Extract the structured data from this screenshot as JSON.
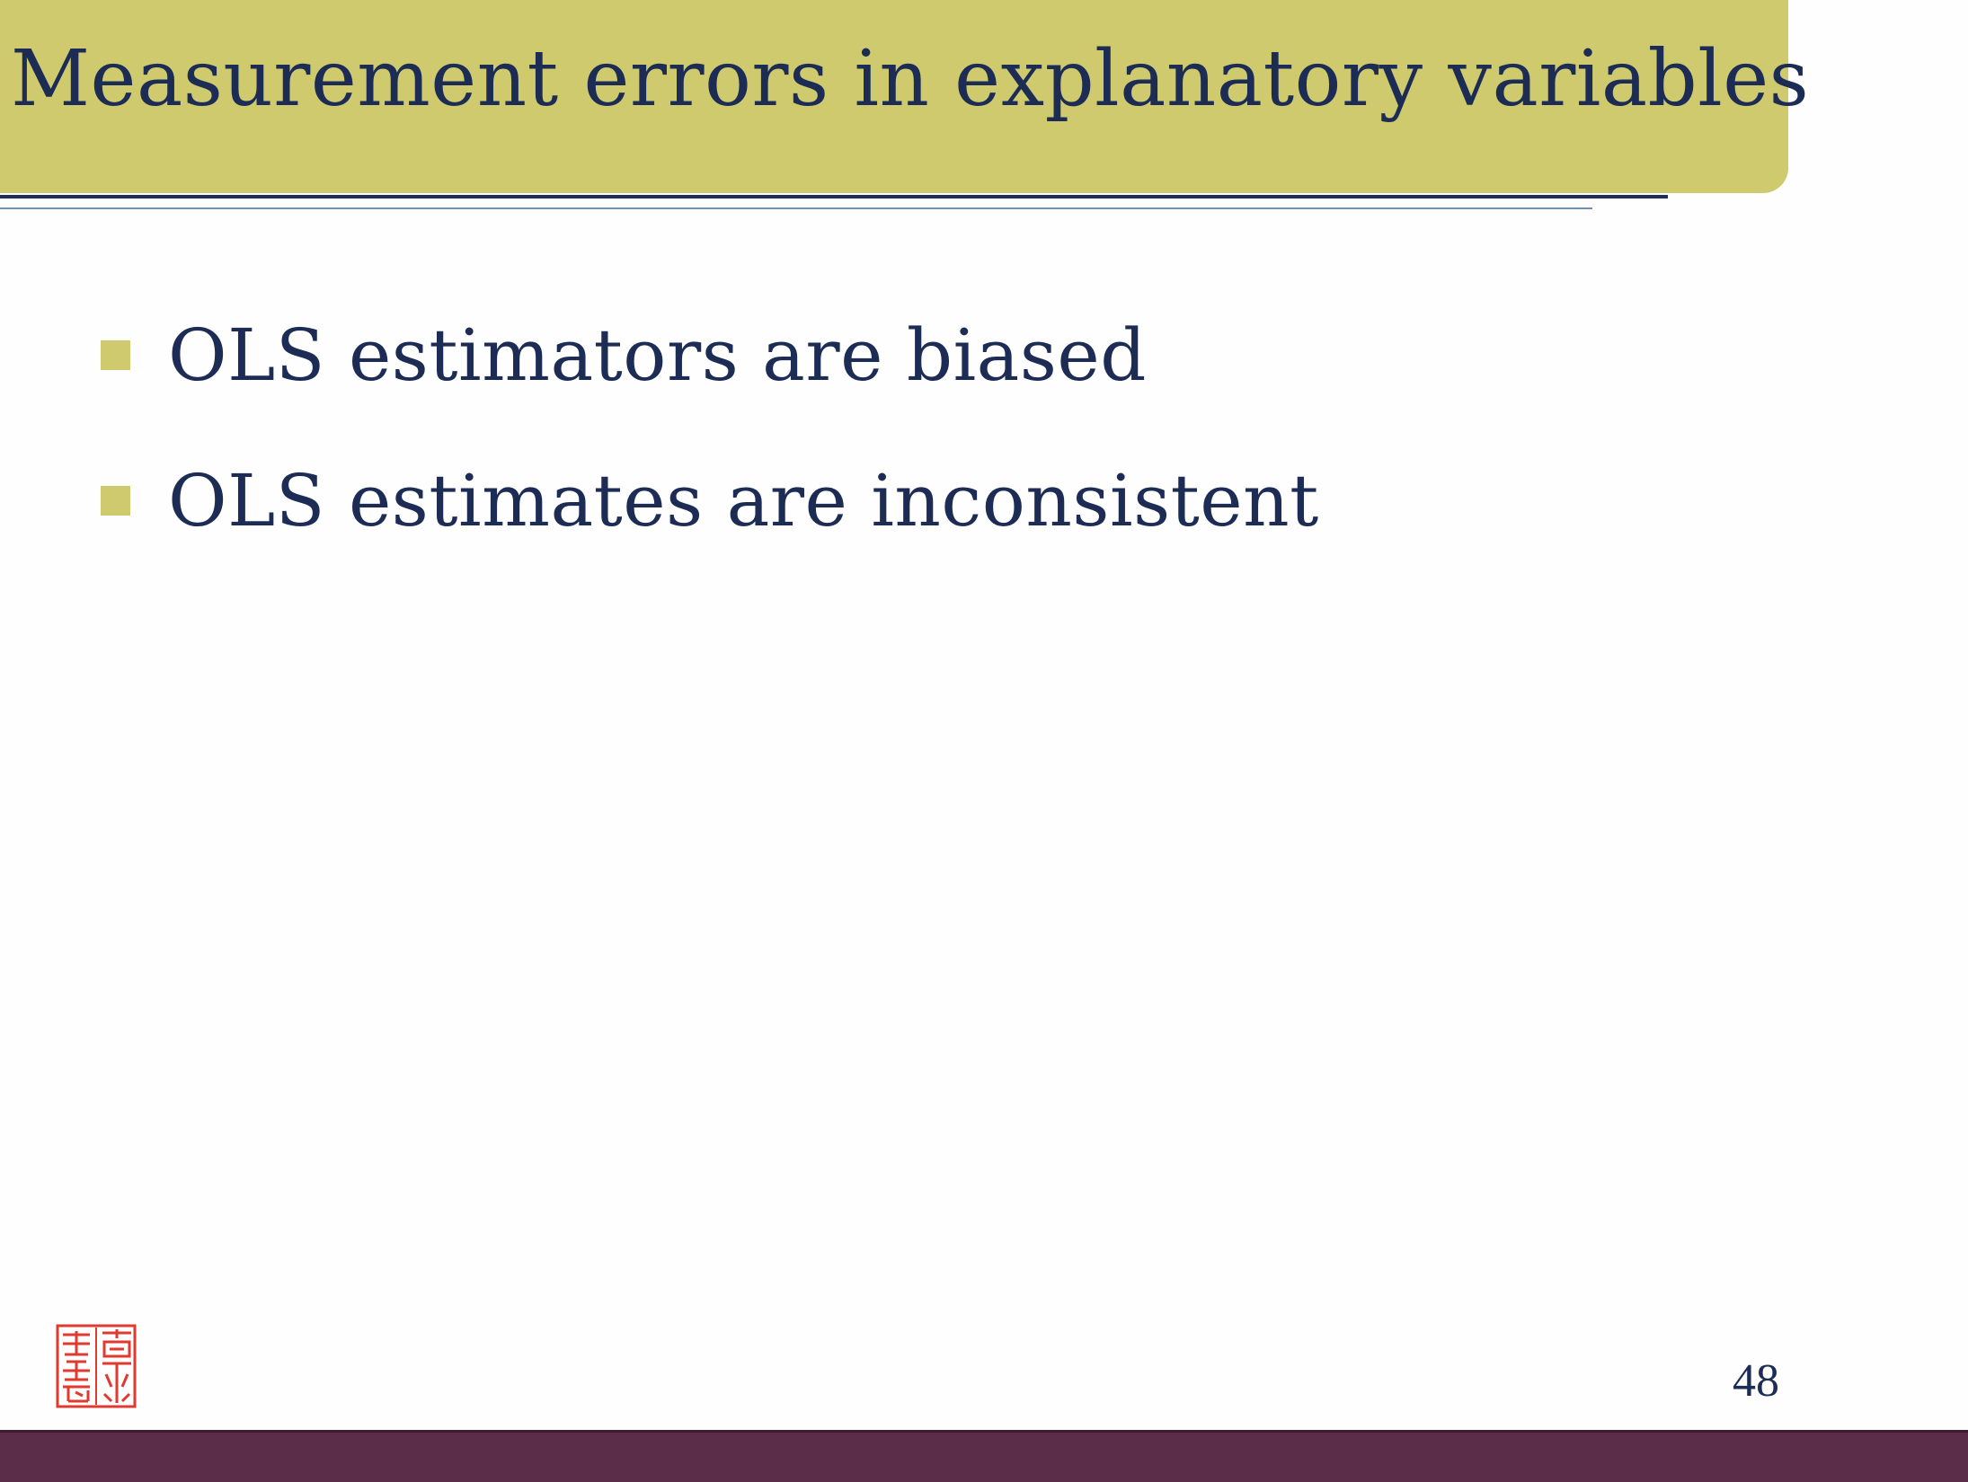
{
  "slide": {
    "title": "Measurement errors in explanatory variables",
    "bullets": [
      "OLS estimators are biased",
      "OLS estimates are inconsistent"
    ],
    "page_number": "48"
  },
  "colors": {
    "title_bar": "#cfca6e",
    "text": "#1c2c55",
    "footer_bar": "#5b2d48",
    "seal": "#e03a2f"
  },
  "icons": {
    "seal": "red-chinese-seal-stamp"
  }
}
